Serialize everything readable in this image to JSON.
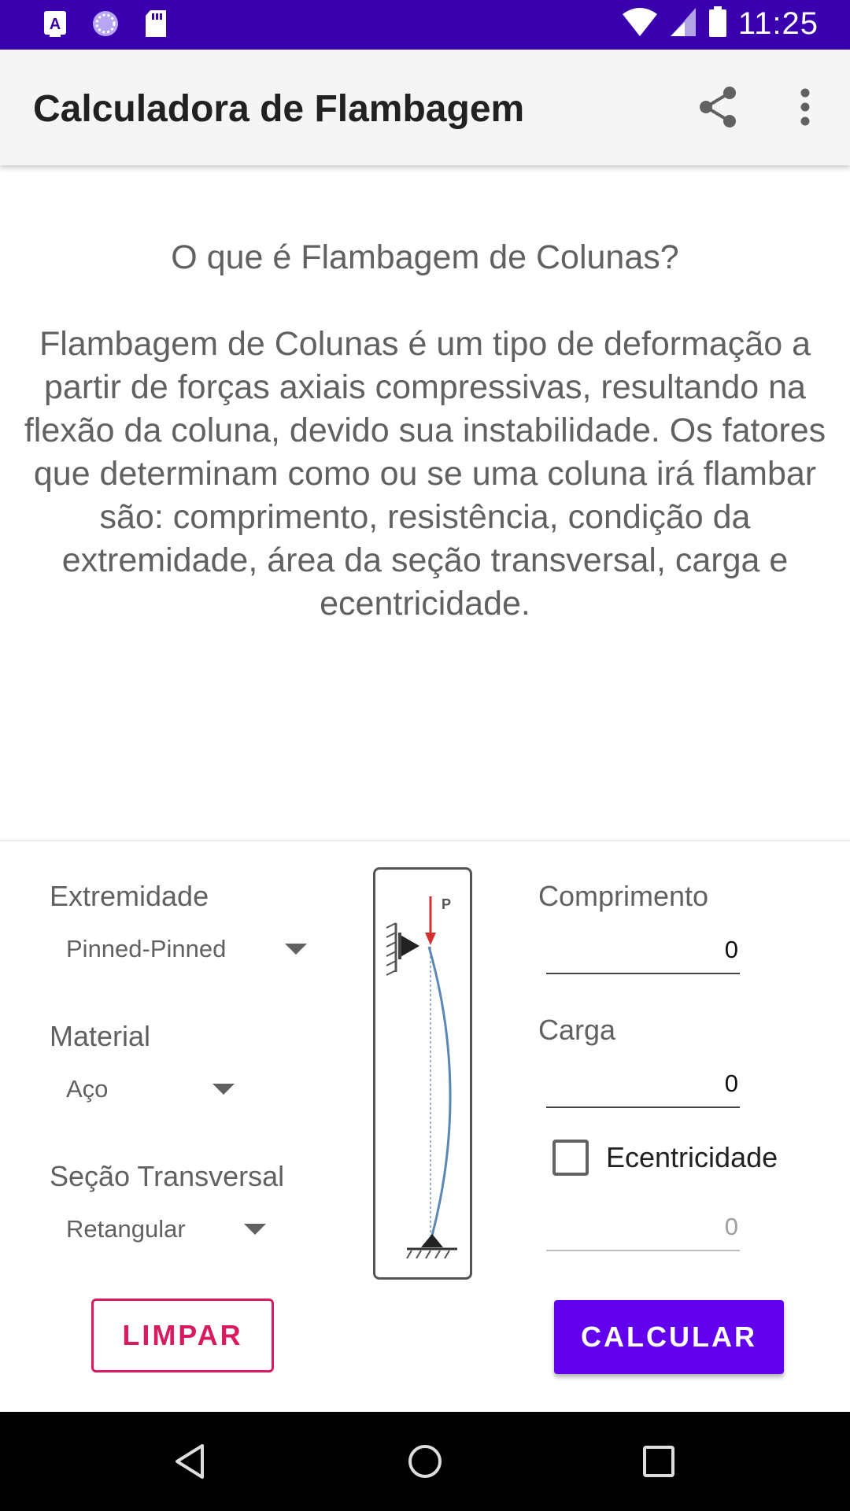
{
  "status_bar": {
    "time": "11:25",
    "icons": [
      "text-a-icon",
      "spinner-icon",
      "sd-card-icon",
      "wifi-icon",
      "signal-icon",
      "battery-icon"
    ]
  },
  "app_bar": {
    "title": "Calculadora de Flambagem",
    "actions": [
      "share-icon",
      "overflow-menu-icon"
    ]
  },
  "intro": {
    "question": "O que é Flambagem de Colunas?",
    "body": "Flambagem de Colunas é um tipo de deformação a partir de forças axiais compressivas, resultando na flexão da coluna, devido sua instabilidade. Os fatores que determinam como ou se uma coluna irá flambar são: comprimento, resistência, condição da extremidade, área da seção transversal, carga e ecentricidade."
  },
  "form": {
    "extremidade": {
      "label": "Extremidade",
      "selected": "Pinned-Pinned"
    },
    "material": {
      "label": "Material",
      "selected": "Aço"
    },
    "secao": {
      "label": "Seção Transversal",
      "selected": "Retangular"
    },
    "comprimento": {
      "label": "Comprimento",
      "value": "0"
    },
    "carga": {
      "label": "Carga",
      "value": "0"
    },
    "ecentricidade": {
      "label": "Ecentricidade",
      "checked": false,
      "value": "0"
    },
    "diagram": {
      "load_label": "P"
    }
  },
  "buttons": {
    "limpar": "LIMPAR",
    "calcular": "CALCULAR"
  },
  "colors": {
    "status_bar": "#3a00b0",
    "primary": "#6200ee",
    "accent": "#d81b60"
  }
}
